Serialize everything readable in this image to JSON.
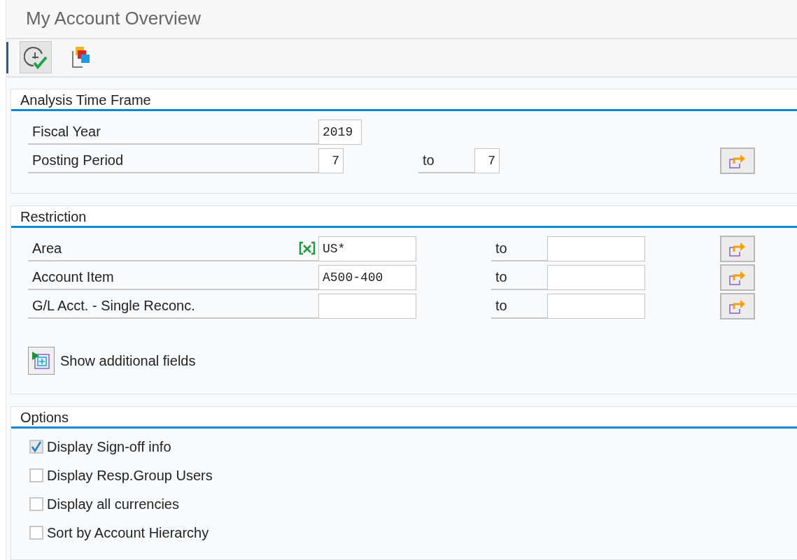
{
  "title": "My Account Overview",
  "toolbar": [
    {
      "kind": "execute"
    },
    {
      "kind": "variants"
    }
  ],
  "time_frame": {
    "title": "Analysis Time Frame",
    "rows": [
      {
        "kind": "year",
        "label": "Fiscal Year",
        "value": "2019",
        "marker": false
      },
      {
        "kind": "period",
        "label": "Posting Period",
        "value": "7",
        "to_label": "to",
        "to_value": "7",
        "marker": false
      }
    ]
  },
  "restriction": {
    "title": "Restriction",
    "rows": [
      {
        "kind": "range",
        "label": "Area",
        "value": "US*",
        "to_label": "to",
        "marker": true
      },
      {
        "kind": "range",
        "label": "Account Item",
        "value": "A500-400",
        "to_label": "to",
        "marker": false
      },
      {
        "kind": "range",
        "label": "G/L Acct. - Single Reconc.",
        "to_label": "to",
        "marker": false
      }
    ],
    "more_button": "Show additional fields"
  },
  "options": {
    "title": "Options",
    "items": [
      {
        "label": "Display Sign-off info",
        "checked": true
      },
      {
        "label": "Display Resp.Group Users",
        "checked": false
      },
      {
        "label": "Display all currencies",
        "checked": false
      },
      {
        "label": "Sort by Account Hierarchy",
        "checked": false
      }
    ]
  }
}
